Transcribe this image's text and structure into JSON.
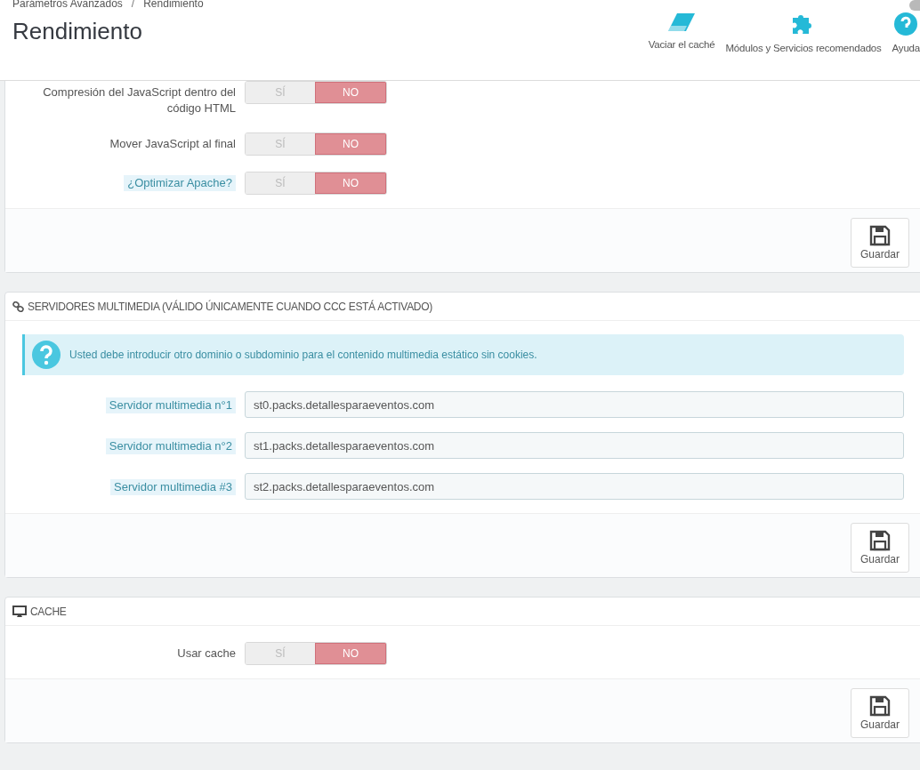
{
  "breadcrumb": [
    "Parámetros Avanzados",
    "Rendimiento"
  ],
  "breadcrumb_separator": "/",
  "page_title": "Rendimiento",
  "toolbar": [
    {
      "kind": "eraser",
      "label": "Vaciar el caché"
    },
    {
      "kind": "puzzle",
      "label": "Módulos y Servicios recomendados"
    },
    {
      "kind": "help",
      "label": "Ayuda"
    }
  ],
  "panels": [
    {
      "rows": [
        {
          "kind": "switch",
          "label": "Compresión del JavaScript dentro del código HTML",
          "help": false,
          "on": false,
          "yes": "SÍ",
          "no": "NO"
        },
        {
          "kind": "switch",
          "label": "Mover JavaScript al final",
          "help": false,
          "on": false,
          "yes": "SÍ",
          "no": "NO"
        },
        {
          "kind": "switch",
          "label": "¿Optimizar Apache?",
          "help": true,
          "on": false,
          "yes": "SÍ",
          "no": "NO"
        }
      ],
      "save": "Guardar"
    },
    {
      "title": "SERVIDORES MULTIMEDIA (VÁLIDO ÚNICAMENTE CUANDO CCC ESTÁ ACTIVADO)",
      "alert": "Usted debe introducir otro dominio o subdominio para el contenido multimedia estático sin cookies.",
      "rows": [
        {
          "kind": "text",
          "label": "Servidor multimedia n°1",
          "help": true,
          "value": "st0.packs.detallesparaeventos.com"
        },
        {
          "kind": "text",
          "label": "Servidor multimedia n°2",
          "help": true,
          "value": "st1.packs.detallesparaeventos.com"
        },
        {
          "kind": "text",
          "label": "Servidor multimedia #3",
          "help": true,
          "value": "st2.packs.detallesparaeventos.com"
        }
      ],
      "save": "Guardar"
    },
    {
      "title": "CACHE",
      "rows": [
        {
          "kind": "switch",
          "label": "Usar cache",
          "help": false,
          "on": false,
          "yes": "SÍ",
          "no": "NO"
        }
      ],
      "save": "Guardar"
    }
  ]
}
